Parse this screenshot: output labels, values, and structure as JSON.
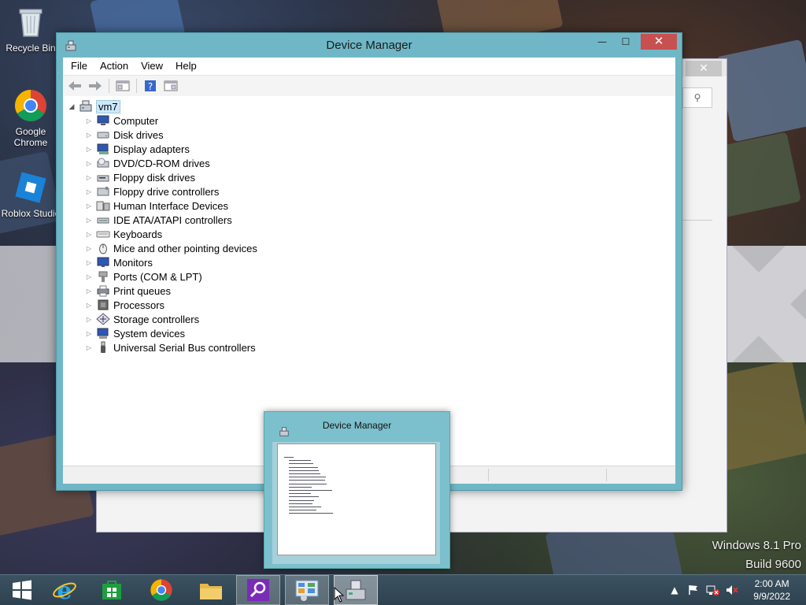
{
  "desktop": {
    "icons": [
      {
        "label": "Recycle Bin"
      },
      {
        "label": "Google Chrome"
      },
      {
        "label": "Roblox Studio"
      }
    ]
  },
  "window": {
    "title": "Device Manager",
    "close_glyph": "✕",
    "min_glyph": "—",
    "max_glyph": "☐",
    "menu": [
      "File",
      "Action",
      "View",
      "Help"
    ],
    "toolbar_icons": [
      "back-icon",
      "forward-icon",
      "properties-icon",
      "help-icon",
      "show-hidden-icon"
    ],
    "tree": {
      "root": "vm7",
      "children": [
        {
          "label": "Computer",
          "icon": "computer-icon"
        },
        {
          "label": "Disk drives",
          "icon": "disk-drive-icon"
        },
        {
          "label": "Display adapters",
          "icon": "display-adapter-icon"
        },
        {
          "label": "DVD/CD-ROM drives",
          "icon": "dvd-drive-icon"
        },
        {
          "label": "Floppy disk drives",
          "icon": "floppy-disk-icon"
        },
        {
          "label": "Floppy drive controllers",
          "icon": "floppy-controller-icon"
        },
        {
          "label": "Human Interface Devices",
          "icon": "hid-icon"
        },
        {
          "label": "IDE ATA/ATAPI controllers",
          "icon": "ide-controller-icon"
        },
        {
          "label": "Keyboards",
          "icon": "keyboard-icon"
        },
        {
          "label": "Mice and other pointing devices",
          "icon": "mouse-icon"
        },
        {
          "label": "Monitors",
          "icon": "monitor-icon"
        },
        {
          "label": "Ports (COM & LPT)",
          "icon": "port-icon"
        },
        {
          "label": "Print queues",
          "icon": "printer-icon"
        },
        {
          "label": "Processors",
          "icon": "processor-icon"
        },
        {
          "label": "Storage controllers",
          "icon": "storage-controller-icon"
        },
        {
          "label": "System devices",
          "icon": "system-device-icon"
        },
        {
          "label": "Universal Serial Bus controllers",
          "icon": "usb-icon"
        }
      ]
    }
  },
  "background_window": {
    "close_glyph": "✕"
  },
  "thumbnail": {
    "title": "Device Manager"
  },
  "watermark": {
    "line1": "Windows 8.1 Pro",
    "line2": "Build 9600"
  },
  "taskbar": {
    "items": [
      "start",
      "internet-explorer",
      "store",
      "chrome",
      "file-explorer",
      "search-app",
      "control-panel",
      "device-manager"
    ],
    "clock": {
      "time": "2:00 AM",
      "date": "9/9/2022"
    }
  },
  "colors": {
    "window_frame": "#6fb7c6",
    "close_red": "#c75050",
    "taskbar": "#2e4250"
  }
}
